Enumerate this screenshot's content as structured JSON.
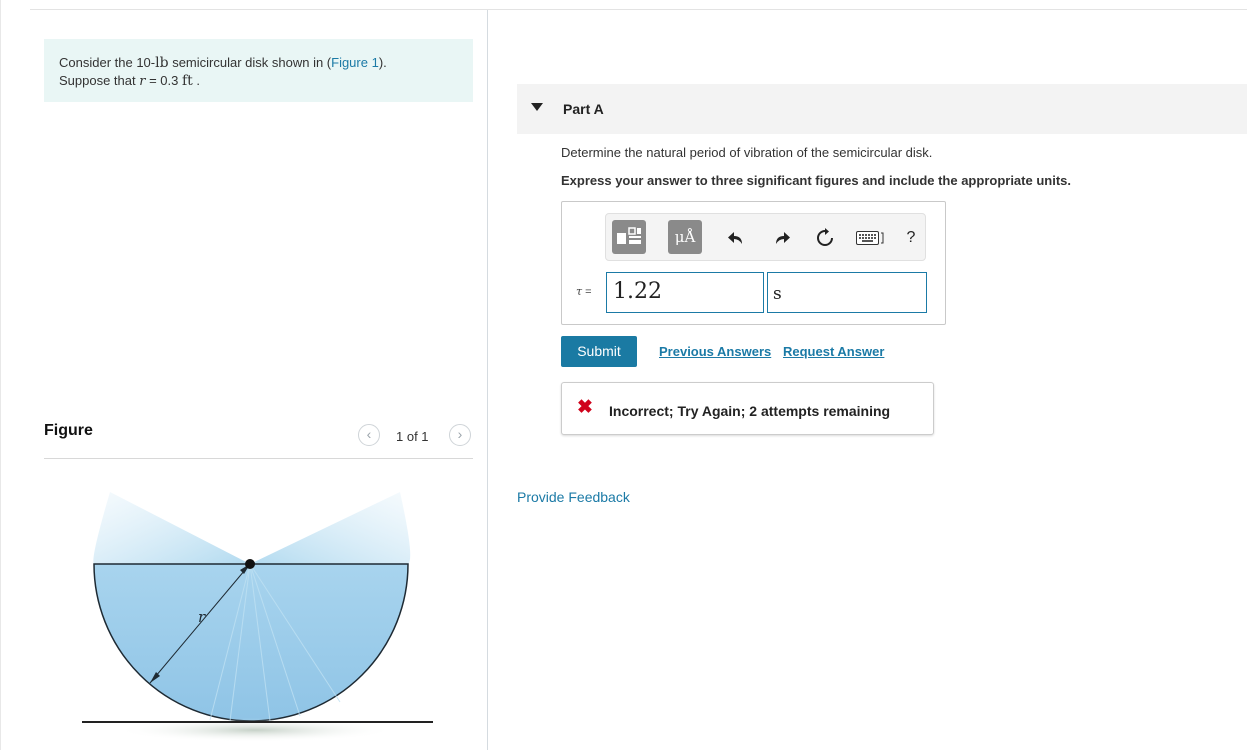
{
  "problem": {
    "line1_prefix": "Consider the 10-",
    "line1_unit": "lb",
    "line1_mid": " semicircular disk shown in (",
    "figure_link": "Figure 1",
    "line1_suffix": ").",
    "line2_prefix": "Suppose that ",
    "var_r": "r",
    "line2_mid": " = 0.3 ",
    "line2_unit": "ft",
    "line2_suffix": " ."
  },
  "figure_panel": {
    "title": "Figure",
    "pager": "1 of 1",
    "prev_icon": "chevron-left-icon",
    "next_icon": "chevron-right-icon",
    "radius_label": "r"
  },
  "part": {
    "title": "Part A",
    "question": "Determine the natural period of vibration of the semicircular disk.",
    "instruction": "Express your answer to three significant figures and include the appropriate units."
  },
  "toolbar": {
    "units_label": "μÅ",
    "help_label": "?",
    "icons": [
      "templates-icon",
      "units-icon",
      "undo-icon",
      "redo-icon",
      "reset-icon",
      "keyboard-icon",
      "help-icon"
    ]
  },
  "answer": {
    "symbol": "τ",
    "equals": " =",
    "value": "1.22",
    "unit": "s"
  },
  "actions": {
    "submit": "Submit",
    "previous_answers": "Previous Answers",
    "request_answer": "Request Answer"
  },
  "result": {
    "message": "Incorrect; Try Again; 2 attempts remaining",
    "icon": "x-icon"
  },
  "footer": {
    "provide_feedback": "Provide Feedback"
  },
  "colors": {
    "accent": "#1a7aa3",
    "error": "#d0021b",
    "problem_bg": "#e9f6f5"
  }
}
